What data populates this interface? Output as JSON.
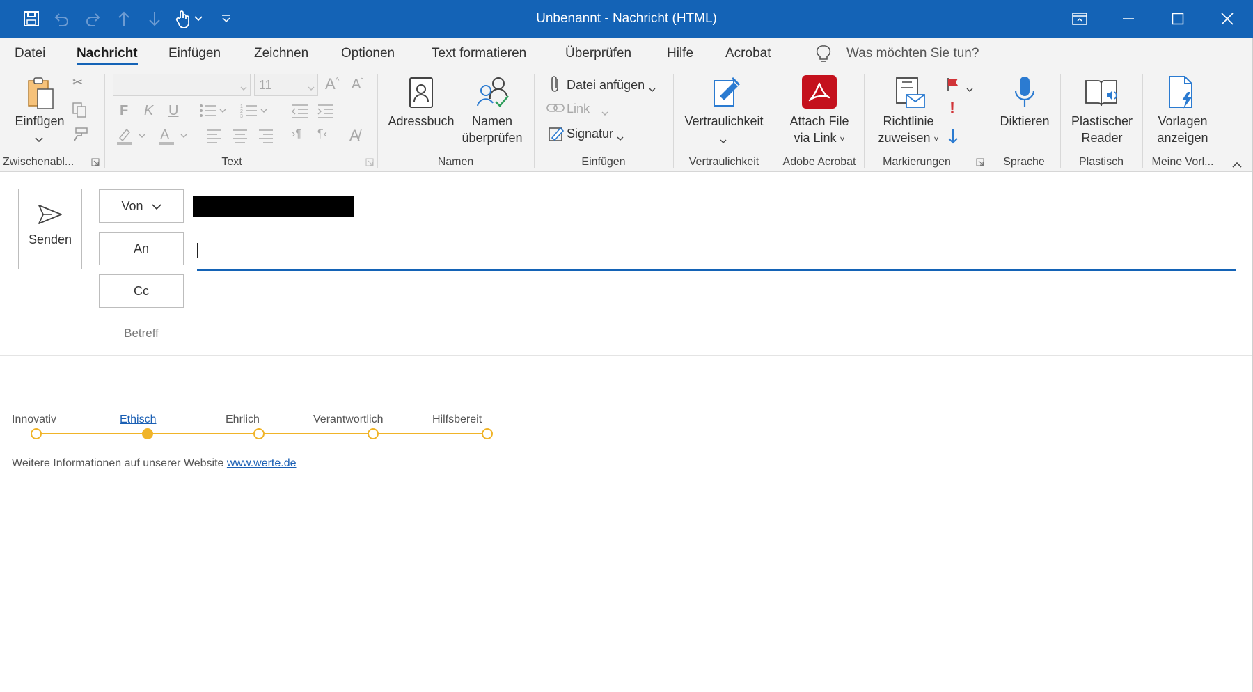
{
  "window": {
    "title": "Unbenannt  -  Nachricht (HTML)"
  },
  "menu": {
    "tabs": [
      "Datei",
      "Nachricht",
      "Einfügen",
      "Zeichnen",
      "Optionen",
      "Text formatieren",
      "Überprüfen",
      "Hilfe",
      "Acrobat"
    ],
    "active": "Nachricht",
    "search_placeholder": "Was möchten Sie tun?"
  },
  "ribbon": {
    "clipboard": {
      "paste": "Einfügen",
      "group": "Zwischenabl..."
    },
    "text": {
      "font_size": "11",
      "bold": "F",
      "italic": "K",
      "underline": "U",
      "group": "Text"
    },
    "names": {
      "addressbook": "Adressbuch",
      "check_names_1": "Namen",
      "check_names_2": "überprüfen",
      "group": "Namen"
    },
    "insert": {
      "attach": "Datei anfügen",
      "link": "Link",
      "signature": "Signatur",
      "group": "Einfügen"
    },
    "confidentiality": {
      "label": "Vertraulichkeit",
      "group": "Vertraulichkeit"
    },
    "acrobat": {
      "label1": "Attach File",
      "label2": "via Link",
      "group": "Adobe Acrobat"
    },
    "tags": {
      "policy1": "Richtlinie",
      "policy2": "zuweisen",
      "group": "Markierungen"
    },
    "voice": {
      "label": "Diktieren",
      "group": "Sprache"
    },
    "immersive": {
      "label1": "Plastischer",
      "label2": "Reader",
      "group": "Plastisch"
    },
    "templates": {
      "label1": "Vorlagen",
      "label2": "anzeigen",
      "group": "Meine Vorl..."
    }
  },
  "compose": {
    "send": "Senden",
    "from": "Von",
    "to": "An",
    "cc": "Cc",
    "subject": "Betreff"
  },
  "body": {
    "values": [
      "Innovativ",
      "Ethisch",
      "Ehrlich",
      "Verantwortlich",
      "Hilfsbereit"
    ],
    "active_value": "Ethisch",
    "info_text": "Weitere Informationen auf unserer Website",
    "link": "www.werte.de"
  },
  "colors": {
    "accent": "#1463b6",
    "timeline": "#f0b429",
    "link": "#1a5fb4"
  }
}
